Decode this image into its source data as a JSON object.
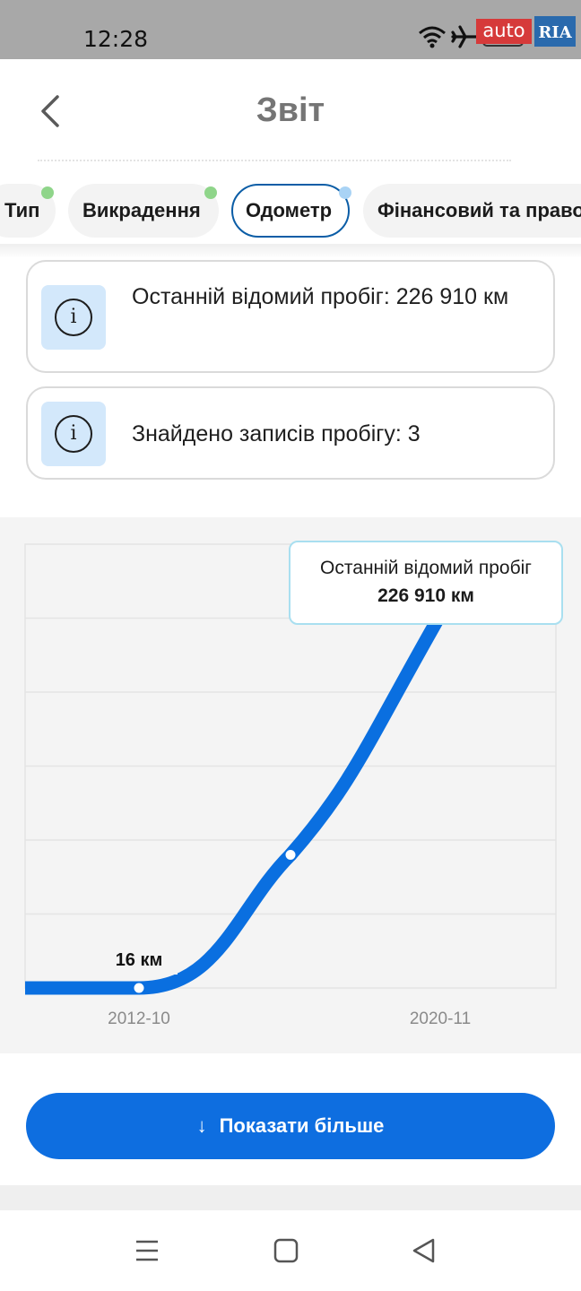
{
  "status_bar": {
    "time": "12:28",
    "icons": [
      "wifi-icon",
      "airplane-icon",
      "battery-icon"
    ],
    "logo_auto": "auto",
    "logo_ria": "RIA"
  },
  "header": {
    "title": "Звіт",
    "back_icon": "chevron-left-icon"
  },
  "tabs": [
    {
      "label": "Тип",
      "status_color": "#8fd58a",
      "active": false
    },
    {
      "label": "Викрадення",
      "status_color": "#8fd58a",
      "active": false
    },
    {
      "label": "Одометр",
      "status_color": "#a9d3f5",
      "active": true
    },
    {
      "label": "Фінансовий та право",
      "status_color": "",
      "active": false
    }
  ],
  "info_cards": [
    {
      "icon": "info-icon",
      "icon_glyph": "i",
      "text": "Останній відомий пробіг: 226 910 км"
    },
    {
      "icon": "info-icon",
      "icon_glyph": "i",
      "text": "Знайдено записів пробігу: 3"
    }
  ],
  "chart_data": {
    "type": "line",
    "title": "",
    "xlabel": "",
    "ylabel": "",
    "x": [
      "2012-10",
      "",
      "2020-11"
    ],
    "tick_labels_x": [
      "2012-10",
      "2020-11"
    ],
    "series": [
      {
        "values": [
          16,
          81000,
          226910
        ],
        "color": "#0a6fe0"
      }
    ],
    "ylim": [
      0,
      270000
    ],
    "grid": true,
    "point_labels": [
      "16 км"
    ],
    "tooltip": {
      "label": "Останній відомий пробіг",
      "value": "226 910 км"
    }
  },
  "actions": {
    "show_more": "Показати більше",
    "show_more_icon": "arrow-down-icon"
  },
  "nav_bar": {
    "icons": [
      "menu-icon",
      "home-square-icon",
      "back-triangle-icon"
    ]
  },
  "colors": {
    "primary": "#0e6ee0",
    "active_tab_border": "#0b5da6",
    "info_bg": "#d3e8fb",
    "green_dot": "#8fd58a",
    "blue_dot": "#a9d3f5"
  }
}
